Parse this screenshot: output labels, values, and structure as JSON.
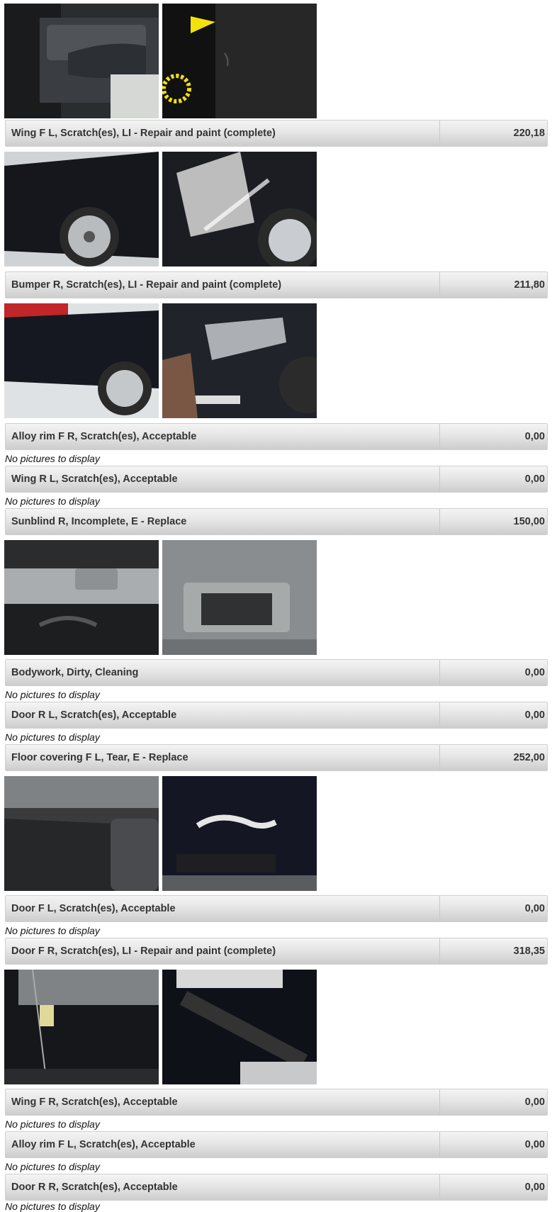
{
  "no_pictures_text": "No pictures to display",
  "items": [
    {
      "label": "Wing F L, Scratch(es), LI - Repair and paint (complete)",
      "amount": "220,18",
      "photos": [
        "door-interior-photo",
        "scratch-closeup-photo"
      ]
    },
    {
      "label": "Bumper R, Scratch(es), LI - Repair and paint (complete)",
      "amount": "211,80",
      "photos": [
        "front-wing-photo",
        "wing-scratch-closeup-photo"
      ]
    },
    {
      "label": "Alloy rim F R, Scratch(es), Acceptable",
      "amount": "0,00",
      "photos": [
        "rear-bumper-photo",
        "bumper-scratch-closeup-photo"
      ]
    },
    {
      "label": "Wing R L, Scratch(es), Acceptable",
      "amount": "0,00"
    },
    {
      "label": "Sunblind R, Incomplete, E - Replace",
      "amount": "150,00"
    },
    {
      "label": "Bodywork, Dirty, Cleaning",
      "amount": "0,00",
      "photos": [
        "interior-sunblind-photo",
        "sunblind-mirror-closeup-photo"
      ]
    },
    {
      "label": "Door R L, Scratch(es), Acceptable",
      "amount": "0,00"
    },
    {
      "label": "Floor covering F L, Tear, E - Replace",
      "amount": "252,00"
    },
    {
      "label": "Door F L, Scratch(es), Acceptable",
      "amount": "0,00",
      "photos": [
        "floor-covering-photo",
        "floor-tear-closeup-photo"
      ]
    },
    {
      "label": "Door F R, Scratch(es), LI - Repair and paint (complete)",
      "amount": "318,35"
    },
    {
      "label": "Wing F R, Scratch(es), Acceptable",
      "amount": "0,00",
      "photos": [
        "front-door-photo",
        "door-scratch-closeup-photo"
      ]
    },
    {
      "label": "Alloy rim F L, Scratch(es), Acceptable",
      "amount": "0,00"
    },
    {
      "label": "Door R R, Scratch(es), Acceptable",
      "amount": "0,00"
    }
  ]
}
